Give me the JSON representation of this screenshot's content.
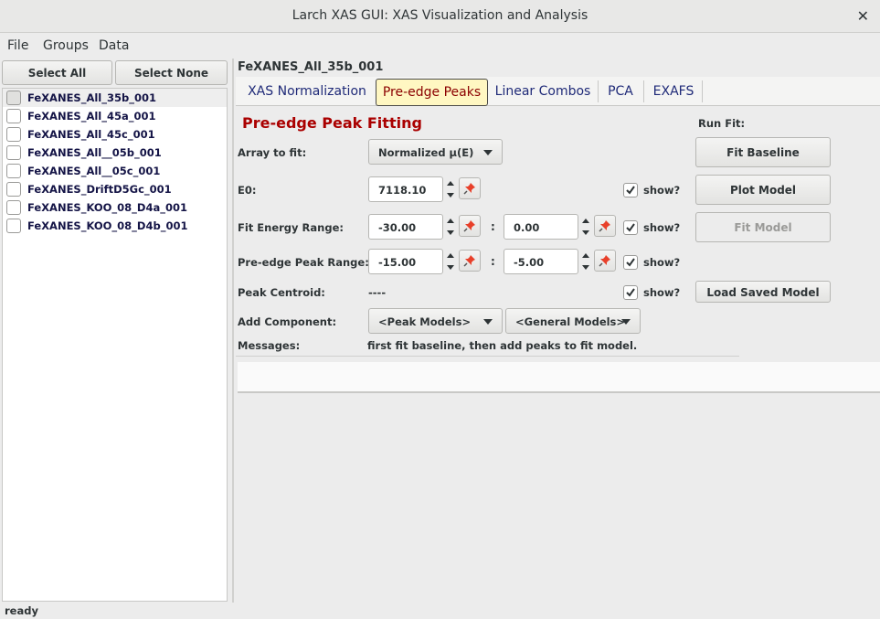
{
  "window": {
    "title": "Larch XAS GUI: XAS Visualization and Analysis",
    "close_glyph": "✕"
  },
  "menu": {
    "items": [
      "File",
      "Groups",
      "Data"
    ]
  },
  "left": {
    "select_all": "Select All",
    "select_none": "Select None",
    "groups": [
      "FeXANES_All_35b_001",
      "FeXANES_All_45a_001",
      "FeXANES_All_45c_001",
      "FeXANES_All__05b_001",
      "FeXANES_All__05c_001",
      "FeXANES_DriftD5Gc_001",
      "FeXANES_KOO_08_D4a_001",
      "FeXANES_KOO_08_D4b_001"
    ]
  },
  "main": {
    "current_group": "FeXANES_All_35b_001",
    "tabs": [
      "XAS Normalization",
      "Pre-edge Peaks",
      "Linear Combos",
      "PCA",
      "EXAFS"
    ],
    "active_tab": "Pre-edge Peaks"
  },
  "preedge": {
    "title": "Pre-edge Peak Fitting",
    "array_label": "Array to fit:",
    "array_value": "Normalized μ(E)",
    "e0_label": "E0:",
    "e0_value": "7118.10",
    "fit_range_label": "Fit Energy Range:",
    "fit_range_min": "-30.00",
    "fit_range_max": "0.00",
    "peak_range_label": "Pre-edge Peak Range:",
    "peak_range_min": "-15.00",
    "peak_range_max": "-5.00",
    "centroid_label": "Peak Centroid:",
    "centroid_value": "----",
    "add_component_label": "Add Component:",
    "peak_models": "<Peak Models>",
    "general_models": "<General Models>",
    "messages_label": "Messages:",
    "messages_value": "first fit baseline, then add peaks to fit model.",
    "colon": ":",
    "show_label": "show?",
    "run_fit_label": "Run Fit:",
    "fit_baseline": "Fit Baseline",
    "plot_model": "Plot Model",
    "fit_model": "Fit Model",
    "load_saved_model": "Load Saved Model"
  },
  "status": {
    "text": "ready"
  },
  "colors": {
    "accent_title": "#aa0000",
    "active_tab_bg": "#fff7c2",
    "tab_text": "#1f2a78"
  }
}
